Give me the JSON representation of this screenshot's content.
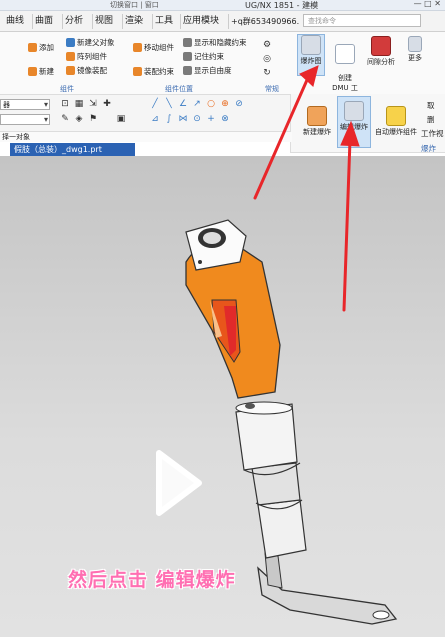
{
  "window": {
    "title": "UG/NX 1851 - 建模",
    "quick_access": "切换窗口 | 窗口",
    "controls": "— □ ✕"
  },
  "menu": {
    "tabs": [
      "曲线",
      "曲面",
      "分析",
      "视图",
      "渲染",
      "工具",
      "应用模块"
    ],
    "group_id": "+q群653490966.",
    "search_placeholder": "查找命令"
  },
  "ribbon": {
    "col1": [
      "添加",
      "新建"
    ],
    "col2": [
      "新建父对象",
      "阵列组件",
      "镜像装配"
    ],
    "col3": [
      "移动组件",
      "装配约束"
    ],
    "col4": [
      "显示和隐藏约束",
      "记住约束",
      "显示自由度"
    ],
    "explode_view": "爆炸图",
    "dmu": "创建\nDMU 工",
    "interference": "间隙分析",
    "more": "更多",
    "groups": {
      "component": "组件",
      "position": "组件位置",
      "general": "常规"
    }
  },
  "explode_panel": {
    "new_explode": "新建爆炸",
    "edit_explode": "编辑爆炸",
    "auto_explode": "自动爆炸组件",
    "workview": "工作视",
    "cut1": "取",
    "cut2": "删",
    "group_label": "爆炸"
  },
  "toolbar2": {
    "filter_value": "器",
    "scope_value": ""
  },
  "hint": "择一对象",
  "file_tab": "假肢（总装）_dwg1.prt",
  "caption": "然后点击 编辑爆炸",
  "colors": {
    "accent": "#3a6ab0",
    "part_orange": "#f08a1e",
    "annotation_red": "#e8262a",
    "caption_pink": "#ff6fb2"
  }
}
